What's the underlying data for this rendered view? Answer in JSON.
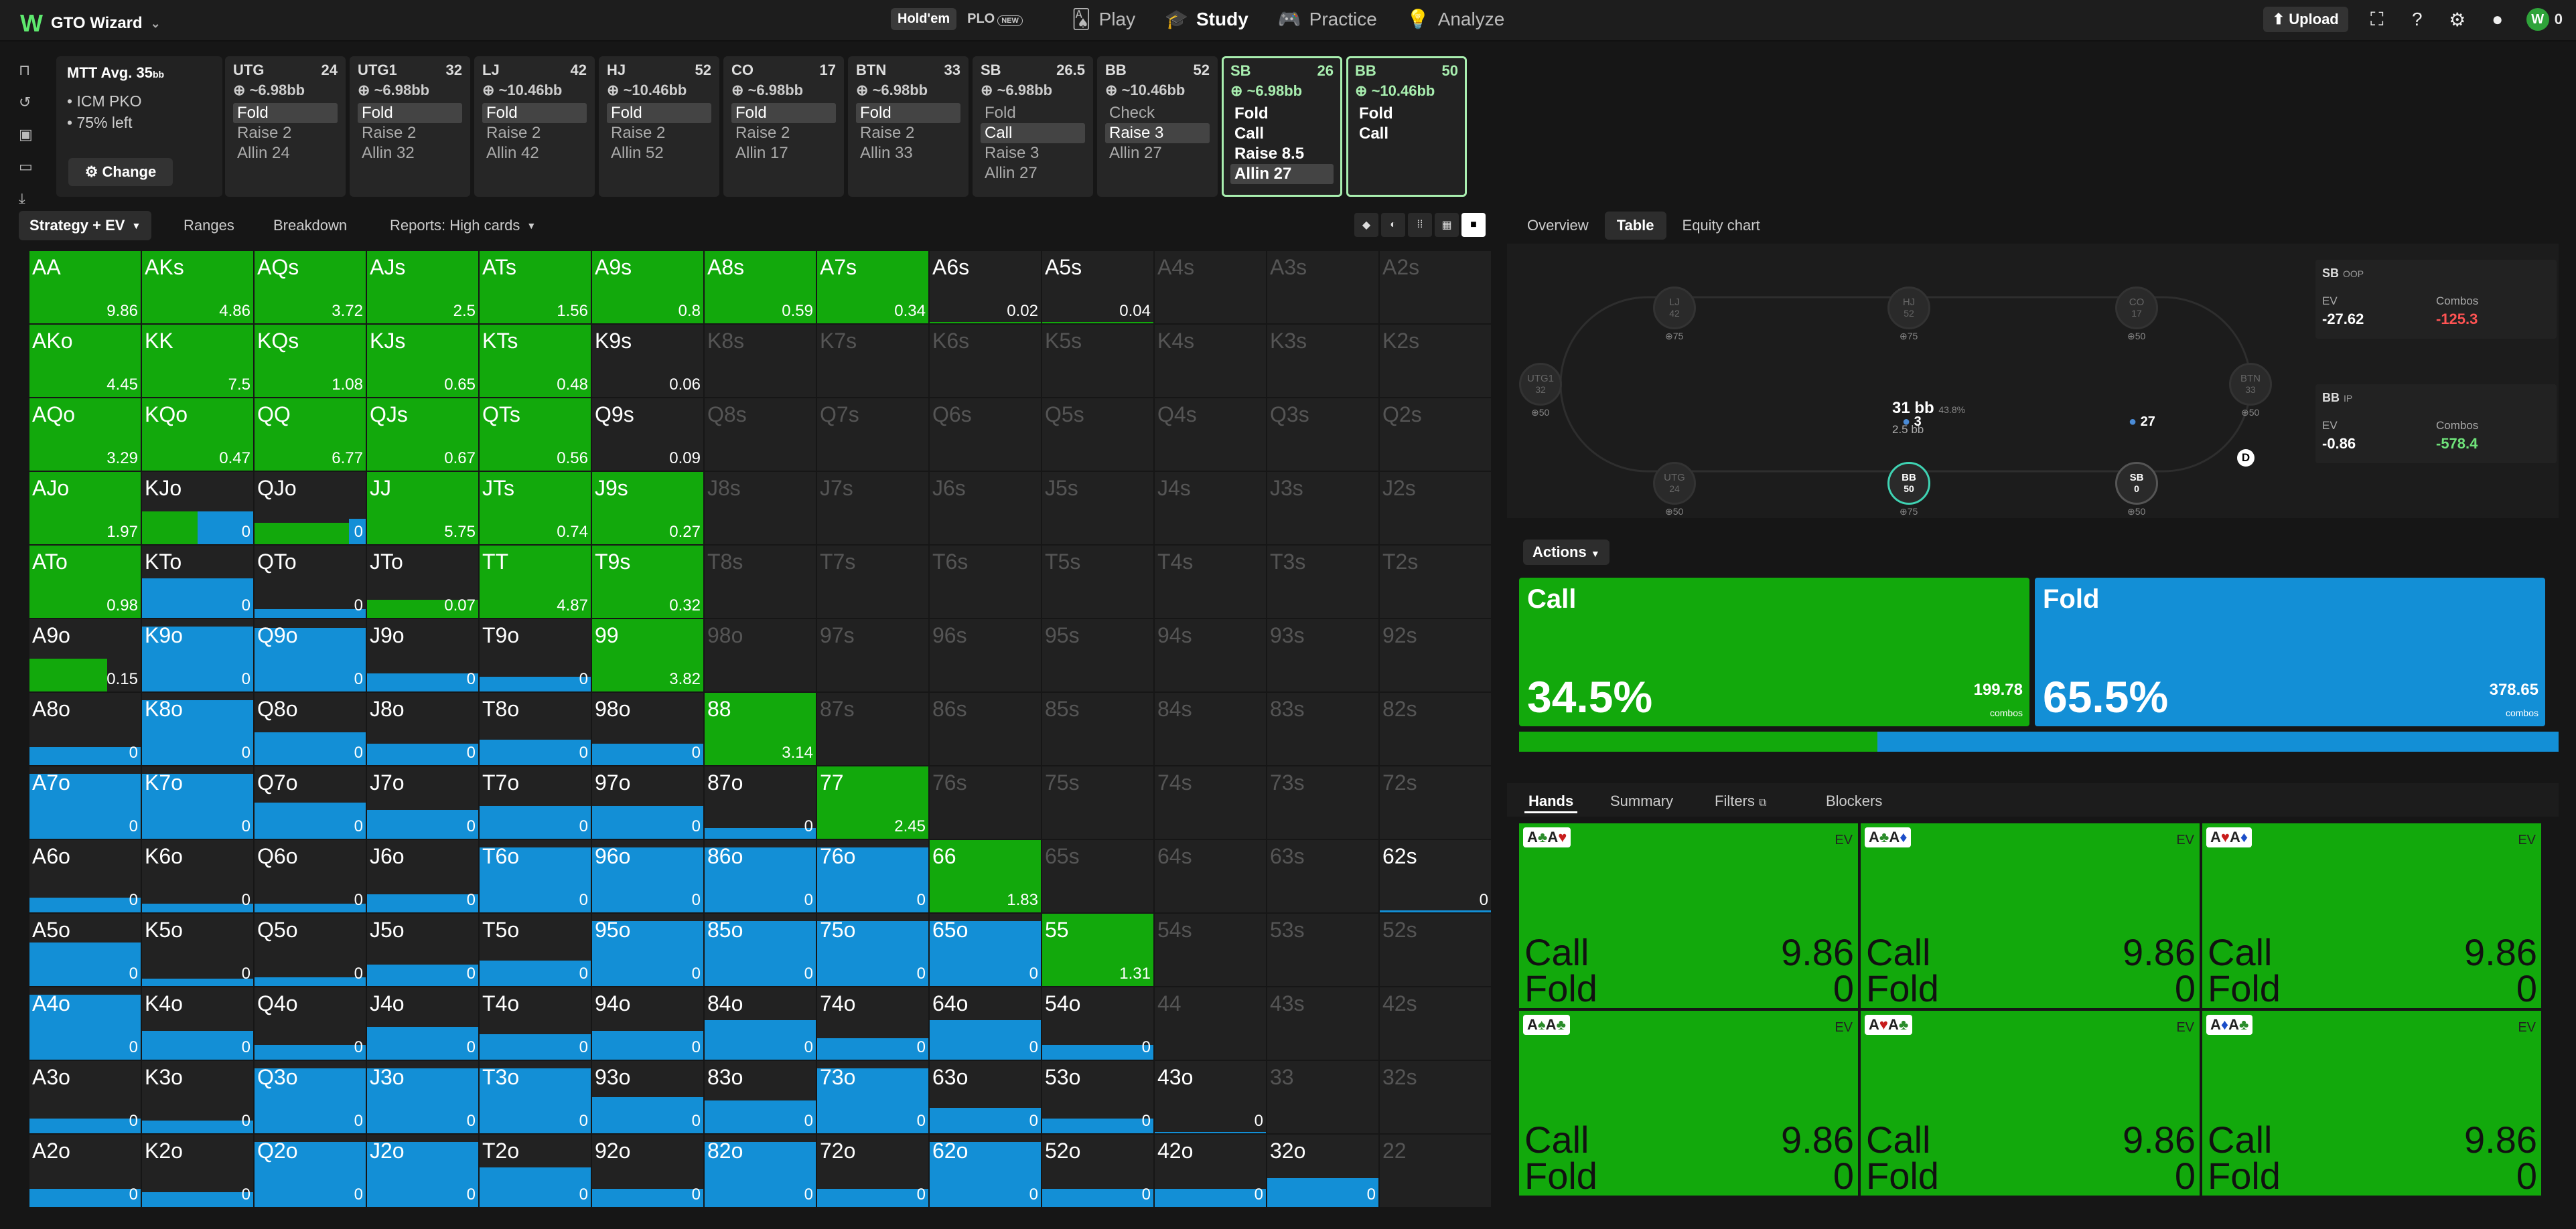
{
  "app": {
    "logo": "GTO Wizard",
    "modes": [
      "Hold'em",
      "PLO"
    ],
    "new_badge": "NEW",
    "nav": [
      "Play",
      "Study",
      "Practice",
      "Analyze"
    ],
    "upload": "Upload",
    "user_count": "0"
  },
  "tournament": {
    "title": "MTT",
    "avg": "Avg. 35",
    "avg_unit": "bb",
    "lines": [
      "ICM PKO",
      "75% left"
    ],
    "change": "Change"
  },
  "positions": [
    {
      "name": "UTG",
      "stack": "24",
      "bounty": "~6.98bb",
      "actions": [
        "Fold",
        "Raise 2",
        "Allin 24"
      ],
      "hl": 0
    },
    {
      "name": "UTG1",
      "stack": "32",
      "bounty": "~6.98bb",
      "actions": [
        "Fold",
        "Raise 2",
        "Allin 32"
      ],
      "hl": 0
    },
    {
      "name": "LJ",
      "stack": "42",
      "bounty": "~10.46bb",
      "actions": [
        "Fold",
        "Raise 2",
        "Allin 42"
      ],
      "hl": 0
    },
    {
      "name": "HJ",
      "stack": "52",
      "bounty": "~10.46bb",
      "actions": [
        "Fold",
        "Raise 2",
        "Allin 52"
      ],
      "hl": 0
    },
    {
      "name": "CO",
      "stack": "17",
      "bounty": "~6.98bb",
      "actions": [
        "Fold",
        "Raise 2",
        "Allin 17"
      ],
      "hl": 0
    },
    {
      "name": "BTN",
      "stack": "33",
      "bounty": "~6.98bb",
      "actions": [
        "Fold",
        "Raise 2",
        "Allin 33"
      ],
      "hl": 0
    },
    {
      "name": "SB",
      "stack": "26.5",
      "bounty": "~6.98bb",
      "actions": [
        "Fold",
        "Call",
        "Raise 3",
        "Allin 27"
      ],
      "hl": 1
    },
    {
      "name": "BB",
      "stack": "52",
      "bounty": "~10.46bb",
      "actions": [
        "Check",
        "Raise 3",
        "Allin 27"
      ],
      "hl": 1
    },
    {
      "name": "SB",
      "stack": "26",
      "bounty": "~6.98bb",
      "actions": [
        "Fold",
        "Call",
        "Raise 8.5",
        "Allin 27"
      ],
      "hl": 3,
      "sel": true
    },
    {
      "name": "BB",
      "stack": "50",
      "bounty": "~10.46bb",
      "actions": [
        "Fold",
        "Call"
      ],
      "hl": -1,
      "sel": true
    }
  ],
  "tabs": [
    "Strategy + EV",
    "Ranges",
    "Breakdown",
    "Reports: High cards"
  ],
  "grid": {
    "colors": {
      "call": "#12a90c",
      "fold": "#138fd6"
    },
    "cells": [
      [
        "AA",
        "1",
        "9.86"
      ],
      [
        "AKs",
        "1",
        "4.86"
      ],
      [
        "AQs",
        "1",
        "3.72"
      ],
      [
        "AJs",
        "1",
        "2.5"
      ],
      [
        "ATs",
        "1",
        "1.56"
      ],
      [
        "A9s",
        "1",
        "0.8"
      ],
      [
        "A8s",
        "1",
        "0.59"
      ],
      [
        "A7s",
        "1",
        "0.34"
      ],
      [
        "A6s",
        "0.02",
        "0.02"
      ],
      [
        "A5s",
        "0.02",
        "0.04"
      ],
      [
        "A4s",
        "-1",
        ""
      ],
      [
        "A3s",
        "-1",
        ""
      ],
      [
        "A2s",
        "-1",
        ""
      ],
      [
        "AKo",
        "1",
        "4.45"
      ],
      [
        "KK",
        "1",
        "7.5"
      ],
      [
        "KQs",
        "1",
        "1.08"
      ],
      [
        "KJs",
        "1",
        "0.65"
      ],
      [
        "KTs",
        "1",
        "0.48"
      ],
      [
        "K9s",
        "0",
        "0.06"
      ],
      [
        "K8s",
        "-1",
        ""
      ],
      [
        "K7s",
        "-1",
        ""
      ],
      [
        "K6s",
        "-1",
        ""
      ],
      [
        "K5s",
        "-1",
        ""
      ],
      [
        "K4s",
        "-1",
        ""
      ],
      [
        "K3s",
        "-1",
        ""
      ],
      [
        "K2s",
        "-1",
        ""
      ],
      [
        "AQo",
        "1",
        "3.29"
      ],
      [
        "KQo",
        "1",
        "0.47"
      ],
      [
        "QQ",
        "1",
        "6.77"
      ],
      [
        "QJs",
        "1",
        "0.67"
      ],
      [
        "QTs",
        "1",
        "0.56"
      ],
      [
        "Q9s",
        "0",
        "0.09"
      ],
      [
        "Q8s",
        "-1",
        ""
      ],
      [
        "Q7s",
        "-1",
        ""
      ],
      [
        "Q6s",
        "-1",
        ""
      ],
      [
        "Q5s",
        "-1",
        ""
      ],
      [
        "Q4s",
        "-1",
        ""
      ],
      [
        "Q3s",
        "-1",
        ""
      ],
      [
        "Q2s",
        "-1",
        ""
      ],
      [
        "AJo",
        "1",
        "1.97"
      ],
      [
        "KJo",
        "0.5",
        "0"
      ],
      [
        "QJo",
        "0.3",
        "0"
      ],
      [
        "JJ",
        "1",
        "5.75"
      ],
      [
        "JTs",
        "1",
        "0.74"
      ],
      [
        "J9s",
        "1",
        "0.27"
      ],
      [
        "J8s",
        "-1",
        ""
      ],
      [
        "J7s",
        "-1",
        ""
      ],
      [
        "J6s",
        "-1",
        ""
      ],
      [
        "J5s",
        "-1",
        ""
      ],
      [
        "J4s",
        "-1",
        ""
      ],
      [
        "J3s",
        "-1",
        ""
      ],
      [
        "J2s",
        "-1",
        ""
      ],
      [
        "ATo",
        "1",
        "0.98"
      ],
      [
        "KTo",
        "0",
        "0"
      ],
      [
        "QTo",
        "0",
        "0"
      ],
      [
        "JTo",
        "0.25",
        "0.07"
      ],
      [
        "TT",
        "1",
        "4.87"
      ],
      [
        "T9s",
        "1",
        "0.32"
      ],
      [
        "T8s",
        "-1",
        ""
      ],
      [
        "T7s",
        "-1",
        ""
      ],
      [
        "T6s",
        "-1",
        ""
      ],
      [
        "T5s",
        "-1",
        ""
      ],
      [
        "T4s",
        "-1",
        ""
      ],
      [
        "T3s",
        "-1",
        ""
      ],
      [
        "T2s",
        "-1",
        ""
      ],
      [
        "A9o",
        "0.7",
        "0.15"
      ],
      [
        "K9o",
        "0",
        "0"
      ],
      [
        "Q9o",
        "0",
        "0"
      ],
      [
        "J9o",
        "0",
        "0"
      ],
      [
        "T9o",
        "0",
        "0"
      ],
      [
        "99",
        "1",
        "3.82"
      ],
      [
        "98o",
        "-1",
        ""
      ],
      [
        "97s",
        "-1",
        ""
      ],
      [
        "96s",
        "-1",
        ""
      ],
      [
        "95s",
        "-1",
        ""
      ],
      [
        "94s",
        "-1",
        ""
      ],
      [
        "93s",
        "-1",
        ""
      ],
      [
        "92s",
        "-1",
        ""
      ],
      [
        "A8o",
        "0",
        "0"
      ],
      [
        "K8o",
        "0",
        "0"
      ],
      [
        "Q8o",
        "0",
        "0"
      ],
      [
        "J8o",
        "0",
        "0"
      ],
      [
        "T8o",
        "0",
        "0"
      ],
      [
        "98o",
        "0",
        "0"
      ],
      [
        "88",
        "1",
        "3.14"
      ],
      [
        "87s",
        "-1",
        ""
      ],
      [
        "86s",
        "-1",
        ""
      ],
      [
        "85s",
        "-1",
        ""
      ],
      [
        "84s",
        "-1",
        ""
      ],
      [
        "83s",
        "-1",
        ""
      ],
      [
        "82s",
        "-1",
        ""
      ],
      [
        "A7o",
        "0",
        "0"
      ],
      [
        "K7o",
        "0",
        "0"
      ],
      [
        "Q7o",
        "0",
        "0"
      ],
      [
        "J7o",
        "0",
        "0"
      ],
      [
        "T7o",
        "0",
        "0"
      ],
      [
        "97o",
        "0",
        "0"
      ],
      [
        "87o",
        "0",
        "0"
      ],
      [
        "77",
        "1",
        "2.45"
      ],
      [
        "76s",
        "-1",
        ""
      ],
      [
        "75s",
        "-1",
        ""
      ],
      [
        "74s",
        "-1",
        ""
      ],
      [
        "73s",
        "-1",
        ""
      ],
      [
        "72s",
        "-1",
        ""
      ],
      [
        "A6o",
        "0",
        "0"
      ],
      [
        "K6o",
        "0",
        "0"
      ],
      [
        "Q6o",
        "0",
        "0"
      ],
      [
        "J6o",
        "0",
        "0"
      ],
      [
        "T6o",
        "0",
        "0"
      ],
      [
        "96o",
        "0",
        "0"
      ],
      [
        "86o",
        "0",
        "0"
      ],
      [
        "76o",
        "0",
        "0"
      ],
      [
        "66",
        "1",
        "1.83"
      ],
      [
        "65s",
        "-1",
        ""
      ],
      [
        "64s",
        "-1",
        ""
      ],
      [
        "63s",
        "-1",
        ""
      ],
      [
        "62s",
        "0",
        "0"
      ],
      [
        "A5o",
        "0",
        "0"
      ],
      [
        "K5o",
        "0",
        "0"
      ],
      [
        "Q5o",
        "0",
        "0"
      ],
      [
        "J5o",
        "0",
        "0"
      ],
      [
        "T5o",
        "0",
        "0"
      ],
      [
        "95o",
        "0",
        "0"
      ],
      [
        "85o",
        "0",
        "0"
      ],
      [
        "75o",
        "0",
        "0"
      ],
      [
        "65o",
        "0",
        "0"
      ],
      [
        "55",
        "1",
        "1.31"
      ],
      [
        "54s",
        "-1",
        ""
      ],
      [
        "53s",
        "-1",
        ""
      ],
      [
        "52s",
        "-1",
        ""
      ],
      [
        "A4o",
        "0",
        "0"
      ],
      [
        "K4o",
        "0",
        "0"
      ],
      [
        "Q4o",
        "0",
        "0"
      ],
      [
        "J4o",
        "0",
        "0"
      ],
      [
        "T4o",
        "0",
        "0"
      ],
      [
        "94o",
        "0",
        "0"
      ],
      [
        "84o",
        "0",
        "0"
      ],
      [
        "74o",
        "0",
        "0"
      ],
      [
        "64o",
        "0",
        "0"
      ],
      [
        "54o",
        "0",
        "0"
      ],
      [
        "44",
        "-1",
        ""
      ],
      [
        "43s",
        "-1",
        ""
      ],
      [
        "42s",
        "-1",
        ""
      ],
      [
        "A3o",
        "0",
        "0"
      ],
      [
        "K3o",
        "0",
        "0"
      ],
      [
        "Q3o",
        "0",
        "0"
      ],
      [
        "J3o",
        "0",
        "0"
      ],
      [
        "T3o",
        "0",
        "0"
      ],
      [
        "93o",
        "0",
        "0"
      ],
      [
        "83o",
        "0",
        "0"
      ],
      [
        "73o",
        "0",
        "0"
      ],
      [
        "63o",
        "0",
        "0"
      ],
      [
        "53o",
        "0",
        "0"
      ],
      [
        "43o",
        "0",
        "0"
      ],
      [
        "33",
        "-1",
        ""
      ],
      [
        "32s",
        "-1",
        ""
      ],
      [
        "A2o",
        "0",
        "0"
      ],
      [
        "K2o",
        "0",
        "0"
      ],
      [
        "Q2o",
        "0",
        "0"
      ],
      [
        "J2o",
        "0",
        "0"
      ],
      [
        "T2o",
        "0",
        "0"
      ],
      [
        "92o",
        "0",
        "0"
      ],
      [
        "82o",
        "0",
        "0"
      ],
      [
        "72o",
        "0",
        "0"
      ],
      [
        "62o",
        "0",
        "0"
      ],
      [
        "52o",
        "0",
        "0"
      ],
      [
        "42o",
        "0",
        "0"
      ],
      [
        "32o",
        "0",
        "0"
      ],
      [
        "22",
        "-1",
        ""
      ]
    ],
    "fold_heights": [
      0,
      0,
      0,
      0,
      0,
      0,
      0,
      0,
      0,
      0,
      0,
      0,
      0,
      0,
      0,
      0,
      0,
      0,
      0,
      0,
      0,
      0,
      0,
      0,
      0,
      0,
      0,
      0,
      0,
      0,
      0,
      0,
      0,
      0,
      0,
      0,
      0,
      0,
      0,
      0,
      0.5,
      0.3,
      0,
      0,
      0,
      0,
      0,
      0,
      0,
      0,
      0,
      0,
      0,
      0.55,
      0.12,
      0,
      0,
      0,
      0,
      0,
      0,
      0,
      0,
      0,
      0,
      0,
      0.9,
      0.88,
      0.25,
      0.2,
      0,
      0,
      0,
      0,
      0,
      0,
      0,
      0,
      0.25,
      0.9,
      0.45,
      0.3,
      0.35,
      0.3,
      0,
      0,
      0,
      0,
      0,
      0,
      0,
      0.9,
      0.9,
      0.5,
      0.4,
      0.45,
      0.45,
      0.15,
      0,
      0,
      0,
      0,
      0,
      0,
      0.2,
      0.12,
      0.12,
      0.25,
      0.9,
      0.9,
      0.9,
      0.9,
      0,
      0,
      0,
      0,
      0.03,
      0.6,
      0.1,
      0.12,
      0.3,
      0.35,
      0.9,
      0.9,
      0.9,
      0.9,
      0,
      0,
      0,
      0,
      0.9,
      0.4,
      0.2,
      0.45,
      0.35,
      0.4,
      0.55,
      0.3,
      0.55,
      0.2,
      0,
      0,
      0,
      0.2,
      0.18,
      0.9,
      0.9,
      0.9,
      0.5,
      0.45,
      0.9,
      0.35,
      0.2,
      0.02,
      0,
      0,
      0.25,
      0.2,
      0.9,
      0.9,
      0.55,
      0.25,
      0.9,
      0.25,
      0.9,
      0.25,
      0.25,
      0.4,
      0
    ]
  },
  "right_tabs": [
    "Overview",
    "Table",
    "Equity chart"
  ],
  "table": {
    "seats": [
      {
        "name": "LJ",
        "stack": "42",
        "sub": "75"
      },
      {
        "name": "HJ",
        "stack": "52",
        "sub": "75"
      },
      {
        "name": "CO",
        "stack": "17",
        "sub": "50"
      },
      {
        "name": "UTG1",
        "stack": "32",
        "sub": "50"
      },
      {
        "name": "BTN",
        "stack": "33",
        "sub": "50"
      },
      {
        "name": "UTG",
        "stack": "24",
        "sub": "50"
      },
      {
        "name": "BB",
        "stack": "50",
        "sub": "75"
      },
      {
        "name": "SB",
        "stack": "0",
        "sub": "50"
      }
    ],
    "pot": "31 bb",
    "pot_pct": "43.8%",
    "pot_bb": "2.5 bb",
    "bet_bb": "3",
    "bet_sb": "27",
    "dealer": "D",
    "sb_box": {
      "name": "SB",
      "pos": "OOP",
      "ev_label": "EV",
      "ev": "-27.62",
      "combos_label": "Combos",
      "combos": "-125.3"
    },
    "bb_box": {
      "name": "BB",
      "pos": "IP",
      "ev_label": "EV",
      "ev": "-0.86",
      "combos_label": "Combos",
      "combos": "-578.4"
    }
  },
  "actions": {
    "label": "Actions",
    "call": {
      "name": "Call",
      "pct": "34.5%",
      "combos": "199.78",
      "combos_label": "combos",
      "freq": 0.345
    },
    "fold": {
      "name": "Fold",
      "pct": "65.5%",
      "combos": "378.65",
      "combos_label": "combos",
      "freq": 0.655
    }
  },
  "hand_tabs": [
    "Hands",
    "Summary",
    "Filters",
    "Blockers"
  ],
  "hands": [
    {
      "c1": "A",
      "s1": "♣",
      "k1": "g",
      "c2": "A",
      "s2": "♥",
      "k2": "r",
      "ev": "EV",
      "call": "Call",
      "callv": "9.86",
      "fold": "Fold",
      "foldv": "0"
    },
    {
      "c1": "A",
      "s1": "♣",
      "k1": "g",
      "c2": "A",
      "s2": "♦",
      "k2": "b",
      "ev": "EV",
      "call": "Call",
      "callv": "9.86",
      "fold": "Fold",
      "foldv": "0"
    },
    {
      "c1": "A",
      "s1": "♥",
      "k1": "r",
      "c2": "A",
      "s2": "♦",
      "k2": "b",
      "ev": "EV",
      "call": "Call",
      "callv": "9.86",
      "fold": "Fold",
      "foldv": "0"
    },
    {
      "c1": "A",
      "s1": "♠",
      "k1": "g",
      "c2": "A",
      "s2": "♣",
      "k2": "g",
      "ev": "EV",
      "call": "Call",
      "callv": "9.86",
      "fold": "Fold",
      "foldv": "0"
    },
    {
      "c1": "A",
      "s1": "♥",
      "k1": "r",
      "c2": "A",
      "s2": "♣",
      "k2": "g",
      "ev": "EV",
      "call": "Call",
      "callv": "9.86",
      "fold": "Fold",
      "foldv": "0"
    },
    {
      "c1": "A",
      "s1": "♦",
      "k1": "b",
      "c2": "A",
      "s2": "♣",
      "k2": "g",
      "ev": "EV",
      "call": "Call",
      "callv": "9.86",
      "fold": "Fold",
      "foldv": "0"
    }
  ]
}
